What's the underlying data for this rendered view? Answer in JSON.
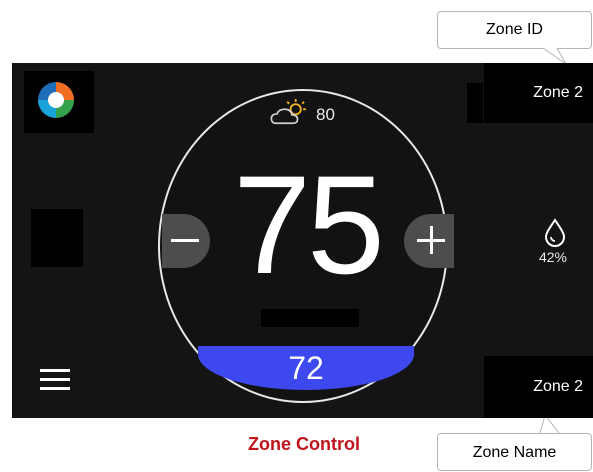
{
  "callouts": {
    "zone_id": "Zone ID",
    "zone_name": "Zone Name"
  },
  "header": {
    "zone_id": "Zone 2"
  },
  "weather": {
    "icon": "partly-sunny-icon",
    "temperature": "80"
  },
  "thermostat": {
    "setpoint": "75",
    "current_temperature": "72",
    "humidity": "42%"
  },
  "footer": {
    "zone_name": "Zone 2"
  },
  "caption": "Zone Control",
  "colors": {
    "screen_bg": "#141414",
    "current_bar": "#3d49ee",
    "caption": "#c0141c"
  }
}
